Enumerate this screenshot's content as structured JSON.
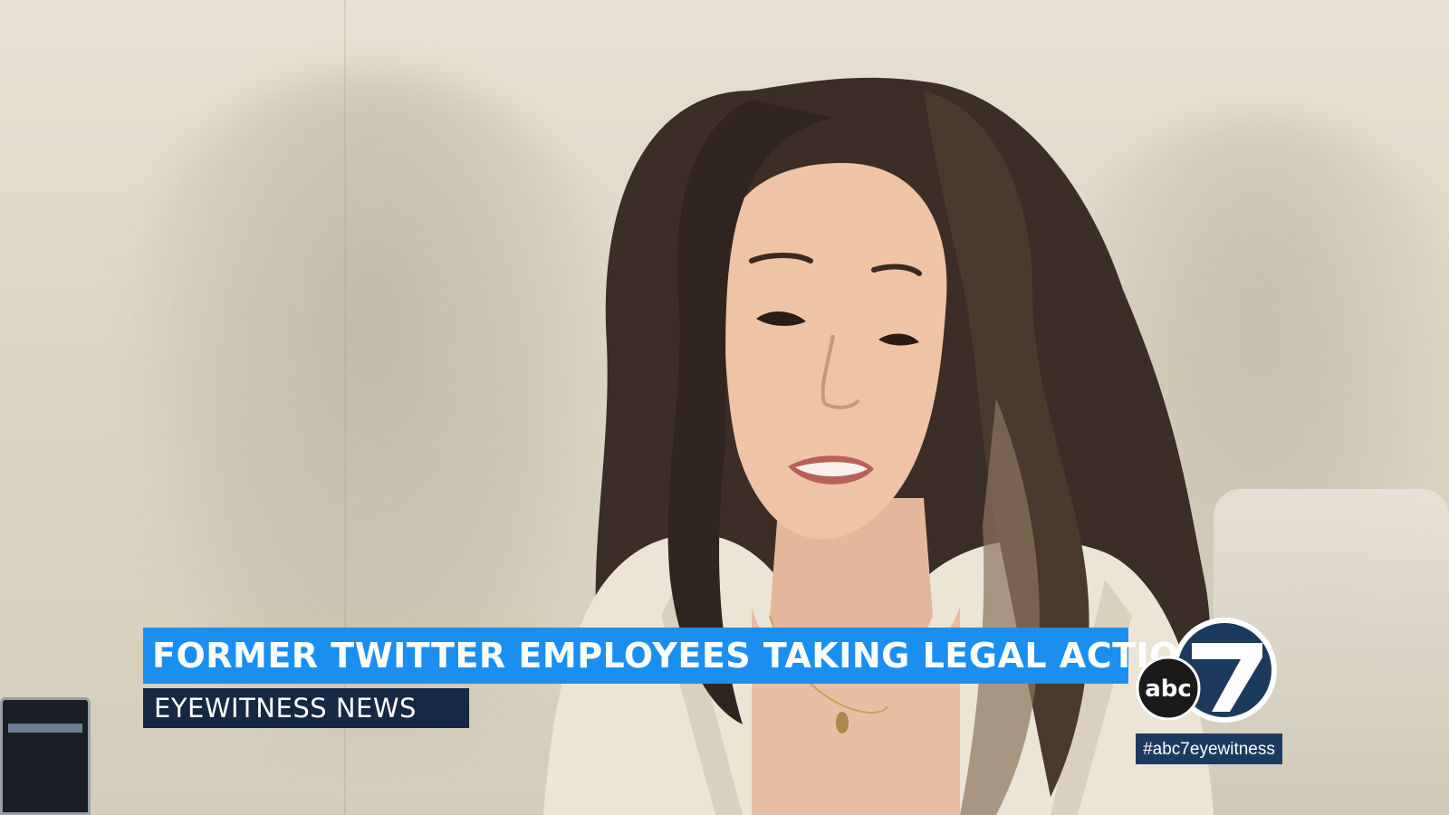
{
  "lower_third": {
    "headline": "FORMER TWITTER EMPLOYEES TAKING LEGAL ACTION",
    "program": "EYEWITNESS NEWS"
  },
  "station": {
    "logo_text": "abc",
    "logo_number": "7",
    "hashtag": "#abc7eyewitness"
  },
  "colors": {
    "headline_bar": "#1a8ff0",
    "program_bar": "#152844",
    "hashtag_bar": "#1c3a5e",
    "wall": "#dcd6c6"
  }
}
